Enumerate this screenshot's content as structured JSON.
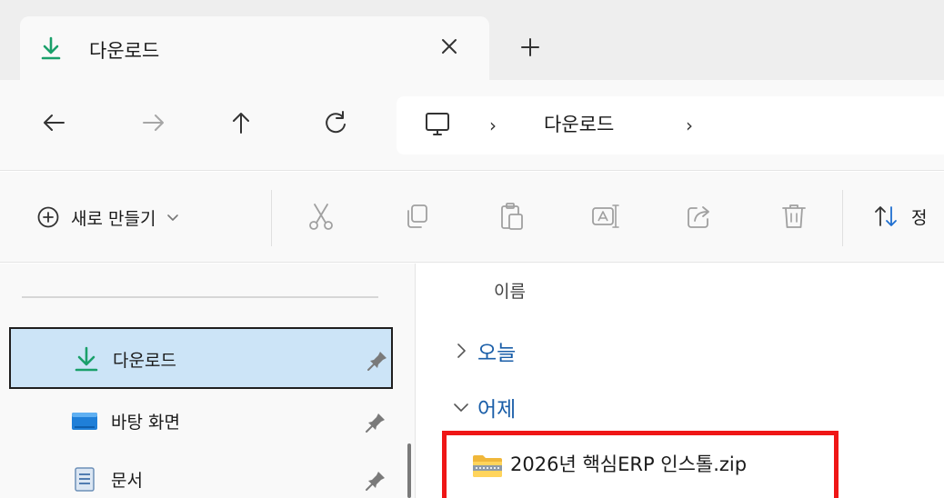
{
  "tab": {
    "title": "다운로드"
  },
  "address": {
    "crumb": "다운로드",
    "sep": "›"
  },
  "command": {
    "new_label": "새로 만들기",
    "sort_label": "정"
  },
  "sidebar": {
    "items": [
      {
        "label": "다운로드"
      },
      {
        "label": "바탕 화면"
      },
      {
        "label": "문서"
      }
    ]
  },
  "content": {
    "column_name": "이름",
    "groups": [
      {
        "label": "오늘",
        "expanded": false
      },
      {
        "label": "어제",
        "expanded": true
      }
    ],
    "files": [
      {
        "name": "2026년 핵심ERP 인스톨.zip",
        "highlighted": true
      }
    ]
  },
  "colors": {
    "download_green": "#1aa06a",
    "highlight_red": "#ef1616",
    "selection_blue": "#cce4f7",
    "group_blue": "#1a5ea8"
  }
}
